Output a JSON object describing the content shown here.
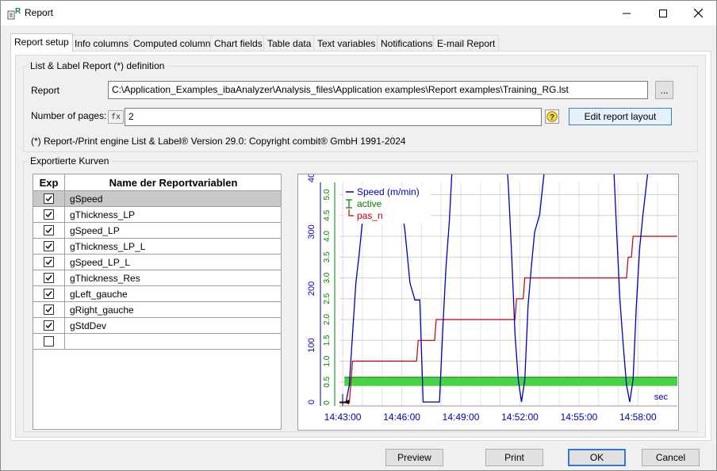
{
  "window": {
    "title": "Report"
  },
  "tabs": [
    {
      "label": "Report setup",
      "active": true
    },
    {
      "label": "Info columns"
    },
    {
      "label": "Computed columns"
    },
    {
      "label": "Chart fields"
    },
    {
      "label": "Table data"
    },
    {
      "label": "Text variables"
    },
    {
      "label": "Notifications"
    },
    {
      "label": "E-mail Report"
    }
  ],
  "definition": {
    "group_title": "List & Label Report (*) definition",
    "report_label": "Report",
    "report_path": "C:\\Application_Examples_ibaAnalyzer\\Analysis_files\\Application examples\\Report examples\\Training_RG.lst",
    "browse_label": "...",
    "pages_label": "Number of pages:",
    "fx_label": "fx",
    "pages_value": "2",
    "edit_layout_label": "Edit report layout",
    "engine_note": "(*) Report-/Print engine List & Label® Version 29.0: Copyright combit® GmbH 1991-2024"
  },
  "curves": {
    "group_title": "Exportierte Kurven",
    "col_exp": "Exp",
    "col_name": "Name der Reportvariablen",
    "rows": [
      {
        "name": "gSpeed",
        "checked": true,
        "selected": true
      },
      {
        "name": "gThickness_LP",
        "checked": true
      },
      {
        "name": "gSpeed_LP",
        "checked": true
      },
      {
        "name": "gThickness_LP_L",
        "checked": true
      },
      {
        "name": "gSpeed_LP_L",
        "checked": true
      },
      {
        "name": "gThickness_Res",
        "checked": true
      },
      {
        "name": "gLeft_gauche",
        "checked": true
      },
      {
        "name": "gRight_gauche",
        "checked": true
      },
      {
        "name": "gStdDev",
        "checked": true
      },
      {
        "name": "",
        "checked": false
      }
    ]
  },
  "chart_data": {
    "type": "line",
    "x_ticks": [
      "14:43:00",
      "14:46:00",
      "14:49:00",
      "14:52:00",
      "14:55:00",
      "14:58:00"
    ],
    "x_unit": "sec",
    "speed_ticks": [
      "0",
      "100",
      "200",
      "300",
      "400"
    ],
    "state_ticks": [
      "0",
      "0.5",
      "1.0",
      "1.5",
      "2.0",
      "2.5",
      "3.0",
      "3.5",
      "4.0",
      "4.5",
      "5.0"
    ],
    "series": [
      {
        "name": "Speed (m/min)",
        "color": "#0000b4"
      },
      {
        "name": "active",
        "color": "#008000"
      },
      {
        "name": "pas_n",
        "color": "#c00000"
      }
    ],
    "speed": [
      [
        "14:42:50",
        0
      ],
      [
        "14:43:10",
        0
      ],
      [
        "14:43:20",
        30
      ],
      [
        "14:43:30",
        120
      ],
      [
        "14:43:40",
        210
      ],
      [
        "14:43:50",
        260
      ],
      [
        "14:44:00",
        320
      ],
      [
        "14:44:10",
        355
      ],
      [
        "14:44:20",
        358
      ],
      [
        "14:45:50",
        358
      ],
      [
        "14:46:00",
        345
      ],
      [
        "14:46:10",
        300
      ],
      [
        "14:46:25",
        210
      ],
      [
        "14:46:40",
        180
      ],
      [
        "14:46:55",
        180
      ],
      [
        "14:47:05",
        0
      ],
      [
        "14:47:55",
        0
      ],
      [
        "14:48:05",
        130
      ],
      [
        "14:48:15",
        240
      ],
      [
        "14:48:25",
        320
      ],
      [
        "14:48:35",
        430
      ],
      [
        "14:48:45",
        465
      ],
      [
        "14:48:55",
        470
      ],
      [
        "14:51:15",
        470
      ],
      [
        "14:51:25",
        380
      ],
      [
        "14:51:35",
        260
      ],
      [
        "14:51:45",
        120
      ],
      [
        "14:51:55",
        40
      ],
      [
        "14:52:05",
        0
      ],
      [
        "14:52:15",
        40
      ],
      [
        "14:52:25",
        170
      ],
      [
        "14:52:35",
        240
      ],
      [
        "14:52:45",
        300
      ],
      [
        "14:53:00",
        330
      ],
      [
        "14:53:15",
        410
      ],
      [
        "14:53:30",
        450
      ],
      [
        "14:53:45",
        505
      ],
      [
        "14:56:35",
        505
      ],
      [
        "14:56:45",
        430
      ],
      [
        "14:56:55",
        300
      ],
      [
        "14:57:05",
        180
      ],
      [
        "14:57:15",
        100
      ],
      [
        "14:57:25",
        30
      ],
      [
        "14:57:35",
        0
      ],
      [
        "14:57:45",
        40
      ],
      [
        "14:57:55",
        170
      ],
      [
        "14:58:05",
        270
      ],
      [
        "14:58:15",
        330
      ],
      [
        "14:58:25",
        380
      ],
      [
        "14:58:35",
        430
      ],
      [
        "14:58:45",
        470
      ],
      [
        "14:58:55",
        505
      ],
      [
        "15:00:00",
        505
      ]
    ],
    "pas_n": [
      [
        "14:42:50",
        0
      ],
      [
        "14:43:20",
        0
      ],
      [
        "14:43:25",
        0.5
      ],
      [
        "14:43:30",
        1.0
      ],
      [
        "14:46:45",
        1.0
      ],
      [
        "14:46:50",
        1.5
      ],
      [
        "14:47:40",
        1.5
      ],
      [
        "14:47:45",
        2.0
      ],
      [
        "14:51:45",
        2.0
      ],
      [
        "14:51:50",
        2.5
      ],
      [
        "14:52:10",
        2.5
      ],
      [
        "14:52:15",
        3.0
      ],
      [
        "14:57:25",
        3.0
      ],
      [
        "14:57:30",
        3.5
      ],
      [
        "14:57:40",
        3.5
      ],
      [
        "14:57:45",
        4.0
      ],
      [
        "15:00:00",
        4.0
      ]
    ],
    "active": [
      [
        "14:42:50",
        0.5
      ],
      [
        "15:00:00",
        0.5
      ]
    ]
  },
  "footer": {
    "preview": "Preview",
    "print": "Print",
    "ok": "OK",
    "cancel": "Cancel"
  }
}
